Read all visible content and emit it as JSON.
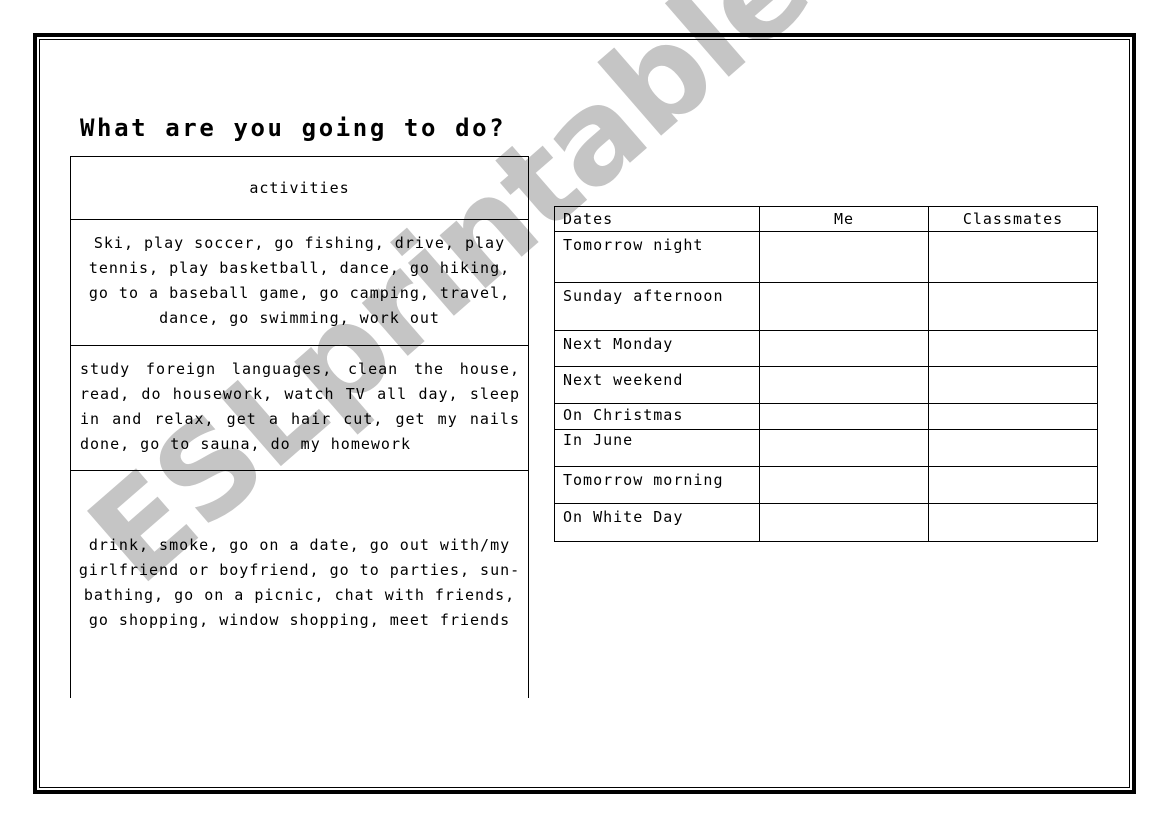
{
  "worksheet": {
    "title": "What are you going to do?",
    "activities_table": {
      "header": "activities",
      "groups": [
        "Ski, play soccer, go fishing, drive, play tennis, play basketball, dance, go hiking, go to a baseball game, go camping, travel, dance, go swimming, work out",
        "study foreign languages, clean the house, read, do housework, watch TV all day, sleep in and relax, get a hair cut, get my nails done, go to sauna, do my homework",
        "drink, smoke, go on a date, go out with/my girlfriend or boyfriend, go to parties, sun-bathing, go on a picnic, chat with friends, go shopping, window shopping, meet friends"
      ]
    },
    "dates_table": {
      "headers": [
        "Dates",
        "Me",
        "Classmates"
      ],
      "rows": [
        {
          "date": "Tomorrow night",
          "me": "",
          "classmates": ""
        },
        {
          "date": "Sunday afternoon",
          "me": "",
          "classmates": ""
        },
        {
          "date": "Next Monday",
          "me": "",
          "classmates": ""
        },
        {
          "date": "Next weekend",
          "me": "",
          "classmates": ""
        },
        {
          "date": "On Christmas",
          "me": "",
          "classmates": ""
        },
        {
          "date": "In June",
          "me": "",
          "classmates": ""
        },
        {
          "date": "Tomorrow morning",
          "me": "",
          "classmates": ""
        },
        {
          "date": "On White Day",
          "me": "",
          "classmates": ""
        }
      ]
    }
  },
  "watermark": {
    "text": "ESLprintables.com",
    "color": "#c4c4c4"
  }
}
